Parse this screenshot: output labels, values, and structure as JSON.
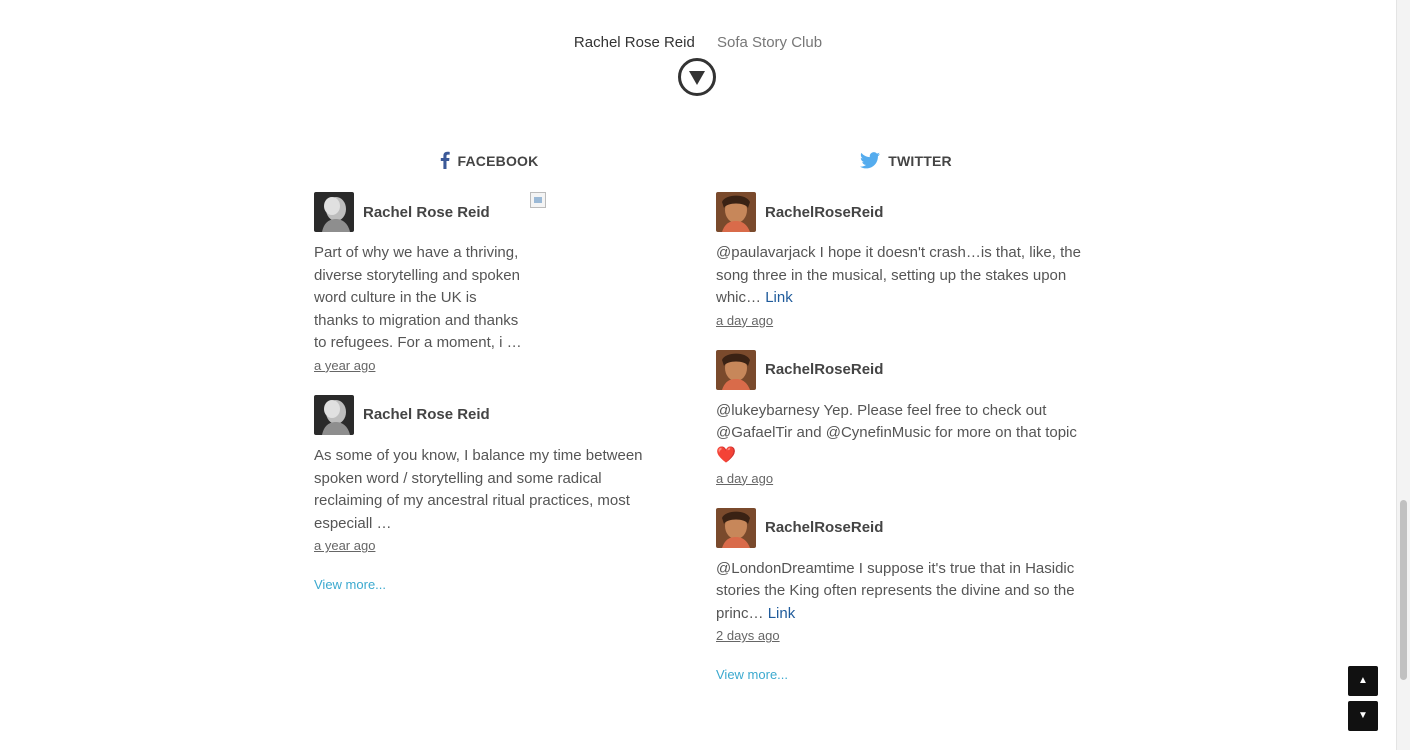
{
  "nav": {
    "items": [
      "Rachel Rose Reid",
      "Sofa Story Club"
    ]
  },
  "facebook": {
    "heading": "FACEBOOK",
    "posts": [
      {
        "author": "Rachel Rose Reid",
        "text": "Part of why we have a thriving, diverse storytelling and spoken word culture in the UK is thanks to migration and thanks to refugees. For a moment, i …",
        "time": "a year ago"
      },
      {
        "author": "Rachel Rose Reid",
        "text": "As some of you know, I balance my time between spoken word / storytelling and some radical reclaiming of my ancestral ritual practices, most especiall …",
        "time": "a year ago"
      }
    ],
    "view_more": "View more..."
  },
  "twitter": {
    "heading": "TWITTER",
    "tweets": [
      {
        "author": "RachelRoseReid",
        "text": "@paulavarjack I hope it doesn't crash…is that, like, the song three in the musical, setting up the stakes upon whic…",
        "link": "Link",
        "time": "a day ago"
      },
      {
        "author": "RachelRoseReid",
        "text": "@lukeybarnesy Yep. Please feel free to check out @GafaelTir and @CynefinMusic for more on that topic",
        "emoji": "❤️",
        "time": "a day ago"
      },
      {
        "author": "RachelRoseReid",
        "text": "@LondonDreamtime I suppose it's true that in Hasidic stories the King often represents the divine and so the princ…",
        "link": "Link",
        "time": "2 days ago"
      }
    ],
    "view_more": "View more..."
  },
  "icons": {
    "nav_toggle": "chevron-down-circle-icon",
    "facebook": "facebook-icon",
    "twitter": "twitter-icon",
    "scroll_up": "arrow-up-icon",
    "scroll_down": "arrow-down-icon"
  },
  "colors": {
    "link": "#3ba9cf",
    "tweet_link": "#1f5b9b",
    "facebook_brand": "#3b5998",
    "twitter_brand": "#55acee"
  }
}
